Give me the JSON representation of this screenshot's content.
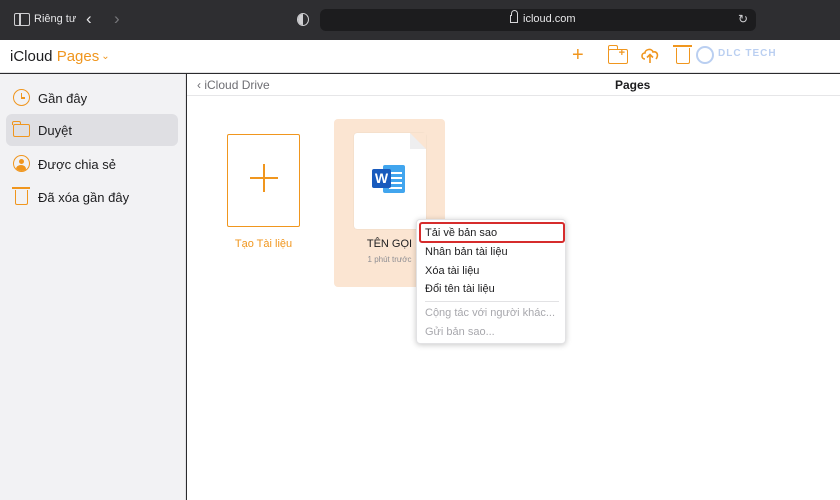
{
  "browser": {
    "private_label": "Riêng tư",
    "url": "icloud.com"
  },
  "app": {
    "brand_prefix": "iCloud",
    "brand_product": "Pages",
    "watermark_text": "DLC TECH",
    "accent_color": "#f0961e"
  },
  "sidebar": {
    "items": [
      {
        "label": "Gần đây",
        "icon": "clock-icon"
      },
      {
        "label": "Duyệt",
        "icon": "folder-icon"
      },
      {
        "label": "Được chia sẻ",
        "icon": "shared-icon"
      },
      {
        "label": "Đã xóa gần đây",
        "icon": "trash-icon"
      }
    ]
  },
  "main": {
    "back_label": "iCloud Drive",
    "title": "Pages",
    "create_label": "Tạo Tài liệu",
    "document": {
      "name": "TÊN GỌI",
      "time": "1 phút trước",
      "file_icon": "word-document-icon"
    }
  },
  "context_menu": {
    "items": [
      {
        "label": "Tải về bản sao",
        "enabled": true,
        "highlighted": true
      },
      {
        "label": "Nhân bản tài liệu",
        "enabled": true
      },
      {
        "label": "Xóa tài liệu",
        "enabled": true
      },
      {
        "label": "Đổi tên tài liệu",
        "enabled": true
      },
      {
        "label": "Cộng tác với người khác...",
        "enabled": false
      },
      {
        "label": "Gửi bản sao...",
        "enabled": false
      }
    ]
  }
}
